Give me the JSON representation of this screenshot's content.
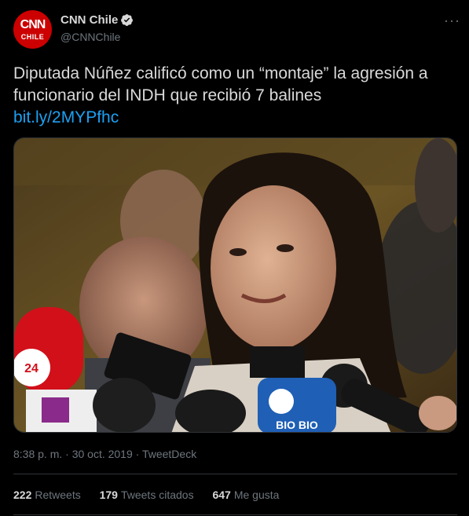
{
  "account": {
    "name": "CNN Chile",
    "handle": "@CNNChile",
    "avatar_text_top": "CNN",
    "avatar_text_bottom": "CHILE",
    "verified": true
  },
  "tweet": {
    "text": "Diputada Núñez calificó como un “montaje” la agresión a funcionario del INDH que recibió 7 balines",
    "link": "bit.ly/2MYPfhc",
    "timestamp": "8:38 p. m. · 30 oct. 2019 · TweetDeck"
  },
  "media": {
    "mic_labels": [
      "24",
      "BIO BIO"
    ]
  },
  "stats": {
    "retweets_count": "222",
    "retweets_label": "Retweets",
    "quotes_count": "179",
    "quotes_label": "Tweets citados",
    "likes_count": "647",
    "likes_label": "Me gusta"
  },
  "colors": {
    "background": "#000000",
    "text": "#d9d9d9",
    "secondary": "#6e767d",
    "link": "#1da1f2",
    "brand": "#cc0000",
    "divider": "#2f3336"
  }
}
